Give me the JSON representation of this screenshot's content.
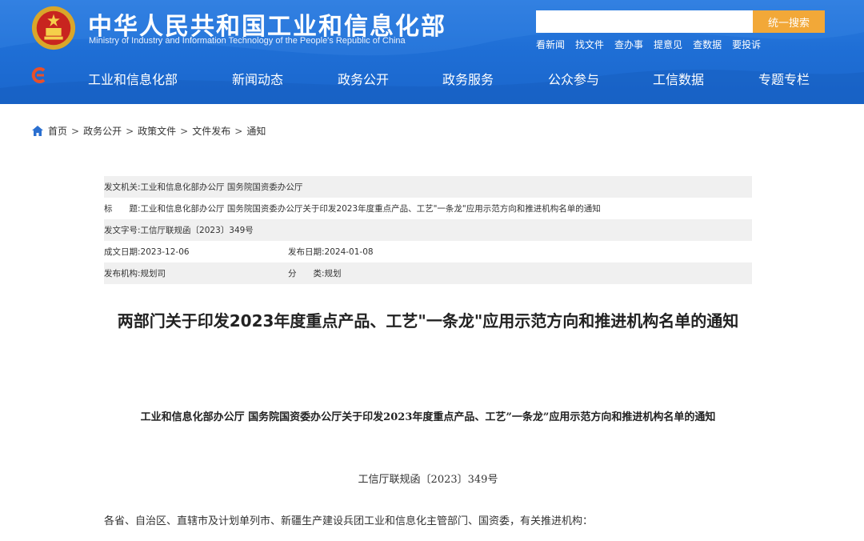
{
  "header": {
    "title": "中华人民共和国工业和信息化部",
    "subtitle": "Ministry of Industry and Information Technology of the People's Republic of China",
    "search_button": "统一搜索",
    "search_placeholder": "",
    "quick_links": [
      "看新闻",
      "找文件",
      "查办事",
      "提意见",
      "查数据",
      "要投诉"
    ]
  },
  "nav": {
    "items": [
      "工业和信息化部",
      "新闻动态",
      "政务公开",
      "政务服务",
      "公众参与",
      "工信数据",
      "专题专栏"
    ]
  },
  "breadcrumb": [
    "首页",
    "政务公开",
    "政策文件",
    "文件发布",
    "通知"
  ],
  "meta": {
    "issuer_label": "发文机关:",
    "issuer": "工业和信息化部办公厅 国务院国资委办公厅",
    "title_label": "标　　题:",
    "title": "工业和信息化部办公厅 国务院国资委办公厅关于印发2023年度重点产品、工艺\"一条龙\"应用示范方向和推进机构名单的通知",
    "doc_no_label": "发文字号:",
    "doc_no": "工信厅联规函〔2023〕349号",
    "created_label": "成文日期:",
    "created": "2023-12-06",
    "published_label": "发布日期:",
    "published": "2024-01-08",
    "org_label": "发布机构:",
    "org": "规划司",
    "category_label": "分　　类:",
    "category": "规划"
  },
  "article": {
    "heading": "两部门关于印发2023年度重点产品、工艺\"一条龙\"应用示范方向和推进机构名单的通知",
    "doc_title": "工业和信息化部办公厅 国务院国资委办公厅关于印发2023年度重点产品、工艺”一条龙”应用示范方向和推进机构名单的通知",
    "doc_number": "工信厅联规函〔2023〕349号",
    "addressee": "各省、自治区、直辖市及计划单列市、新疆生产建设兵团工业和信息化主管部门、国资委，有关推进机构："
  },
  "colors": {
    "header_blue": "#1f6fd6",
    "search_button": "#f2a838",
    "meta_shade": "#f0f0f0"
  }
}
